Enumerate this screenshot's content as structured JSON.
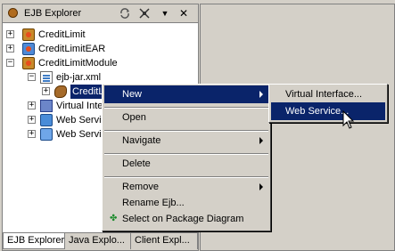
{
  "view": {
    "title": "EJB Explorer",
    "toolbar_icons": [
      "sync-icon",
      "collapse-all-icon",
      "view-menu-icon",
      "close-icon"
    ],
    "close_glyph": "✕",
    "menu_glyph": "▼"
  },
  "tree": {
    "items": [
      {
        "label": "CreditLimit",
        "expander": "+"
      },
      {
        "label": "CreditLimitEAR",
        "expander": "+"
      },
      {
        "label": "CreditLimitModule",
        "expander": "−"
      },
      {
        "label": "ejb-jar.xml",
        "expander": "−"
      },
      {
        "label": "CreditLi",
        "expander": "+"
      },
      {
        "label": "Virtual Inte",
        "expander": "+"
      },
      {
        "label": "Web Servic",
        "expander": "+"
      },
      {
        "label": "Web Servic",
        "expander": "+"
      }
    ]
  },
  "tabs": [
    "EJB Explorer",
    "Java Explo...",
    "Client Expl..."
  ],
  "context_menu": {
    "items": [
      "New",
      "Open",
      "Navigate",
      "Delete",
      "Remove",
      "Rename Ejb...",
      "Select on Package Diagram"
    ]
  },
  "submenu": {
    "items": [
      "Virtual Interface...",
      "Web Service..."
    ]
  }
}
